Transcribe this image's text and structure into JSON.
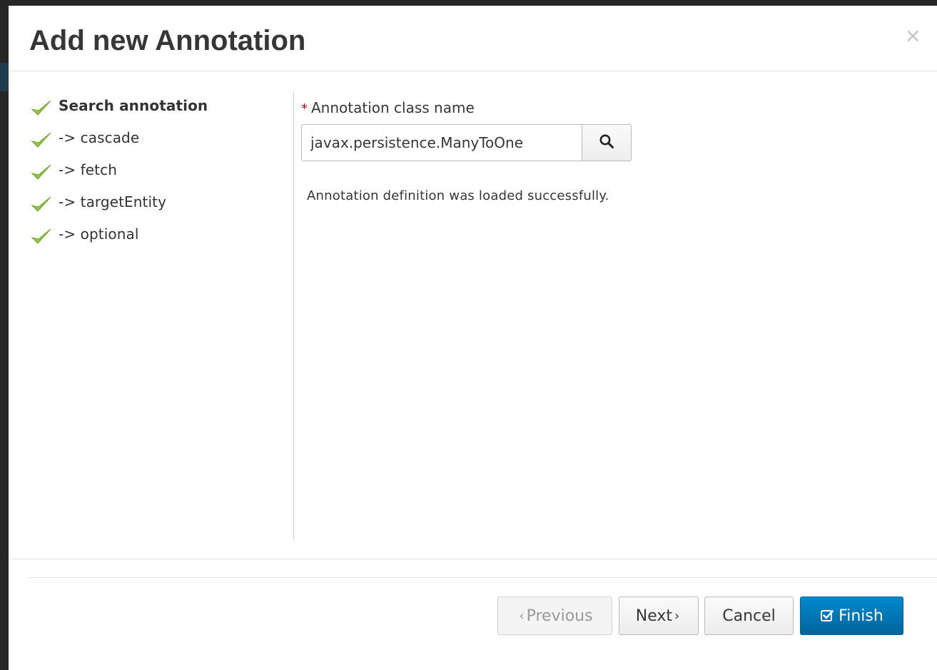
{
  "dialog": {
    "title": "Add new Annotation",
    "close_symbol": "×"
  },
  "wizard": {
    "steps": [
      {
        "label": "Search annotation",
        "icon": "checkmark-icon",
        "active": true
      },
      {
        "label": "-> cascade",
        "icon": "checkmark-icon",
        "active": false
      },
      {
        "label": "-> fetch",
        "icon": "checkmark-icon",
        "active": false
      },
      {
        "label": "-> targetEntity",
        "icon": "checkmark-icon",
        "active": false
      },
      {
        "label": "-> optional",
        "icon": "checkmark-icon",
        "active": false
      }
    ]
  },
  "form": {
    "required_mark": "*",
    "field_label": "Annotation class name",
    "input_value": "javax.persistence.ManyToOne",
    "search_icon": "search-icon",
    "status_message": "Annotation definition was loaded successfully."
  },
  "footer": {
    "previous_chevron": "‹",
    "previous_label": "Previous",
    "next_label": "Next",
    "next_chevron": "›",
    "cancel_label": "Cancel",
    "finish_label": "Finish",
    "finish_icon": "check-square-icon"
  },
  "colors": {
    "check_green": "#8ec63f",
    "primary_blue": "#0088ce",
    "required_red": "#cc0000"
  }
}
